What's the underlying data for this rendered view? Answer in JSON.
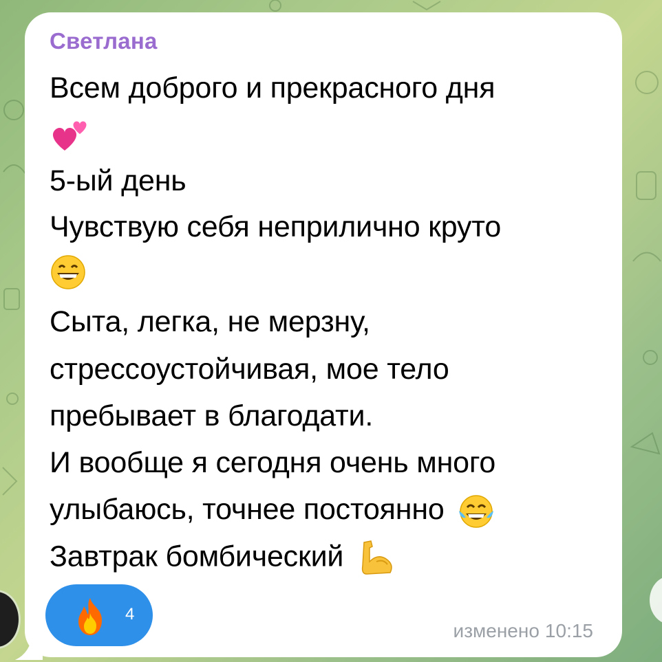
{
  "message": {
    "sender": "Светлана",
    "lines": [
      "Всем доброго и прекрасного дня",
      "5-ый день",
      "Чувствую себя неприлично круто",
      "Сыта, легка, не мерзну,",
      "стрессоустойчивая, мое тело",
      "пребывает в благодати.",
      "И вообще я сегодня очень много",
      "улыбаюсь, точнее постоянно",
      "Завтрак бомбический"
    ],
    "edited_label": "изменено",
    "time": "10:15"
  },
  "reaction": {
    "emoji": "fire-icon",
    "count": "4"
  },
  "colors": {
    "sender": "#9a6ccf",
    "reaction_bg": "#2f90ea",
    "meta_text": "#9aa0a6"
  }
}
